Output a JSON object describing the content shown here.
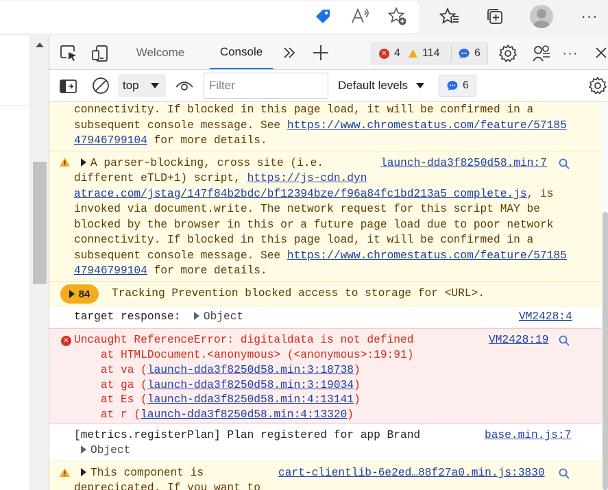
{
  "browser": {
    "icons": [
      "tag-icon",
      "read-aloud-icon",
      "add-favorite-icon",
      "favorites-icon",
      "collections-icon",
      "profile-avatar",
      "more-icon"
    ],
    "more_label": "···"
  },
  "devtools": {
    "tabs": {
      "welcome": "Welcome",
      "console": "Console"
    },
    "issues": {
      "errors": "4",
      "warnings": "114",
      "messages": "6"
    },
    "toolbar": {
      "context": "top",
      "filter_placeholder": "Filter",
      "levels": "Default levels",
      "message_count": "6"
    }
  },
  "console": {
    "warn1": {
      "lines": [
        "connectivity. If blocked in this page load, it will be confirmed in a",
        "subsequent console message. See "
      ],
      "link_a": "https://www.chromestatus.com/feature/57185",
      "link_b": "47946799104",
      "tail": " for more details."
    },
    "warn2": {
      "line1": "A parser-blocking, cross site (i.e.",
      "source": "launch-dda3f8250d58.min:7",
      "line2_prefix": "different eTLD+1) script, ",
      "url_a": "https://js-cdn.dyn",
      "url_b": "atrace.com/jstag/147f84b2bdc/bf12394bze/f96a84fc1bd213a5_complete.js",
      "url_b_tail": ", is",
      "lines": [
        "invoked via document.write. The network request for this script MAY be",
        "blocked by the browser in this or a future page load due to poor network",
        "connectivity. If blocked in this page load, it will be confirmed in a"
      ],
      "line_see": "subsequent console message. See ",
      "link_a": "https://www.chromestatus.com/feature/57185",
      "link_b": "47946799104",
      "tail": " for more details."
    },
    "grouped": {
      "count": "84",
      "text": "Tracking Prevention blocked access to storage for <URL>."
    },
    "target": {
      "label": "target response:  ",
      "object": "Object",
      "source": "VM2428:4"
    },
    "error": {
      "message": "Uncaught ReferenceError: digitaldata is not defined",
      "source": "VM2428:19",
      "frame0": "    at HTMLDocument.<anonymous> (<anonymous>:19:91)",
      "frames": [
        {
          "prefix": "    at va (",
          "link": "launch-dda3f8250d58.min:3:18738",
          "suffix": ")"
        },
        {
          "prefix": "    at ga (",
          "link": "launch-dda3f8250d58.min:3:19034",
          "suffix": ")"
        },
        {
          "prefix": "    at Es (",
          "link": "launch-dda3f8250d58.min:4:13141",
          "suffix": ")"
        },
        {
          "prefix": "    at r (",
          "link": "launch-dda3f8250d58.min:4:13320",
          "suffix": ")"
        }
      ]
    },
    "metrics": {
      "text": "[metrics.registerPlan] Plan registered for app Brand",
      "source": "base.min.js:7",
      "object": "Object"
    },
    "warn3": {
      "line1": "This component is",
      "source": "cart-clientlib-6e2ed…88f27a0.min.js:3830",
      "line2": "deprecicated. If you want to"
    }
  },
  "colors": {
    "accent": "#1a73e8",
    "warning_bg": "#fffbe5",
    "error_bg": "#fdeded",
    "error_text": "#d12a1a",
    "badge": "#f2ad1f"
  }
}
